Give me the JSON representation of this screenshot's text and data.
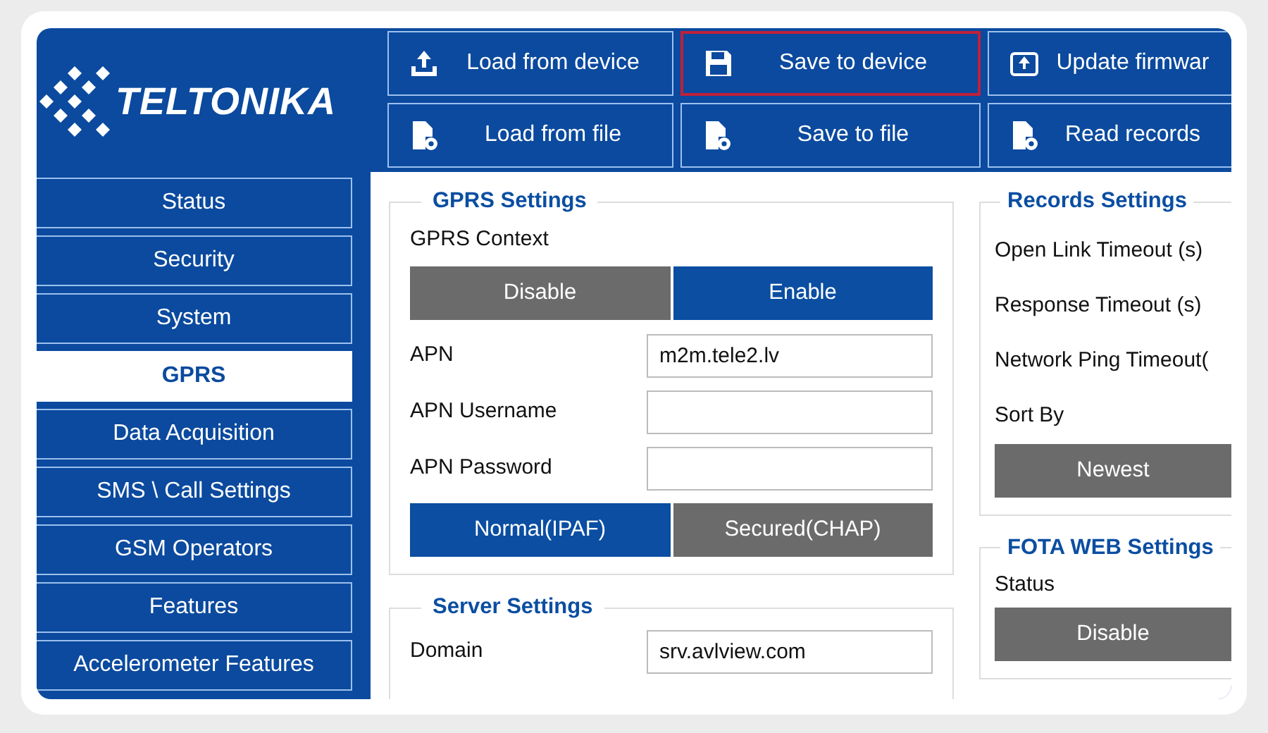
{
  "logo": {
    "text": "TELTONIKA"
  },
  "toolbar": [
    {
      "label": "Load from device",
      "kind": "upload",
      "focused": false
    },
    {
      "label": "Save to device",
      "kind": "save",
      "focused": true
    },
    {
      "label": "Update firmwar",
      "kind": "update",
      "focused": false
    },
    {
      "label": "Load from file",
      "kind": "file",
      "focused": false
    },
    {
      "label": "Save to file",
      "kind": "file",
      "focused": false
    },
    {
      "label": "Read records",
      "kind": "file",
      "focused": false
    }
  ],
  "sidebar": {
    "items": [
      {
        "label": "Status",
        "selected": false
      },
      {
        "label": "Security",
        "selected": false
      },
      {
        "label": "System",
        "selected": false
      },
      {
        "label": "GPRS",
        "selected": true
      },
      {
        "label": "Data Acquisition",
        "selected": false
      },
      {
        "label": "SMS \\ Call Settings",
        "selected": false
      },
      {
        "label": "GSM Operators",
        "selected": false
      },
      {
        "label": "Features",
        "selected": false
      },
      {
        "label": "Accelerometer Features",
        "selected": false
      }
    ]
  },
  "gprs_settings": {
    "title": "GPRS Settings",
    "context_label": "GPRS Context",
    "context_options": [
      {
        "label": "Disable",
        "selected": false
      },
      {
        "label": "Enable",
        "selected": true
      }
    ],
    "fields": [
      {
        "label": "APN",
        "value": "m2m.tele2.lv"
      },
      {
        "label": "APN Username"
      },
      {
        "label": "APN Password"
      }
    ],
    "auth_options": [
      {
        "label": "Normal(IPAF)",
        "selected": true
      },
      {
        "label": "Secured(CHAP)",
        "selected": false
      }
    ]
  },
  "server_settings": {
    "title": "Server Settings",
    "fields": [
      {
        "label": "Domain",
        "value": "srv.avlview.com"
      }
    ]
  },
  "records_settings": {
    "title": "Records Settings",
    "fields": [
      {
        "label": "Open Link Timeout (s)"
      },
      {
        "label": "Response Timeout (s)"
      },
      {
        "label": "Network Ping Timeout("
      }
    ],
    "sort_label": "Sort By",
    "sort_options": [
      {
        "label": "Newest",
        "selected": false
      }
    ]
  },
  "fota_settings": {
    "title": "FOTA WEB Settings",
    "status_label": "Status",
    "status_options": [
      {
        "label": "Disable",
        "selected": false
      }
    ]
  }
}
